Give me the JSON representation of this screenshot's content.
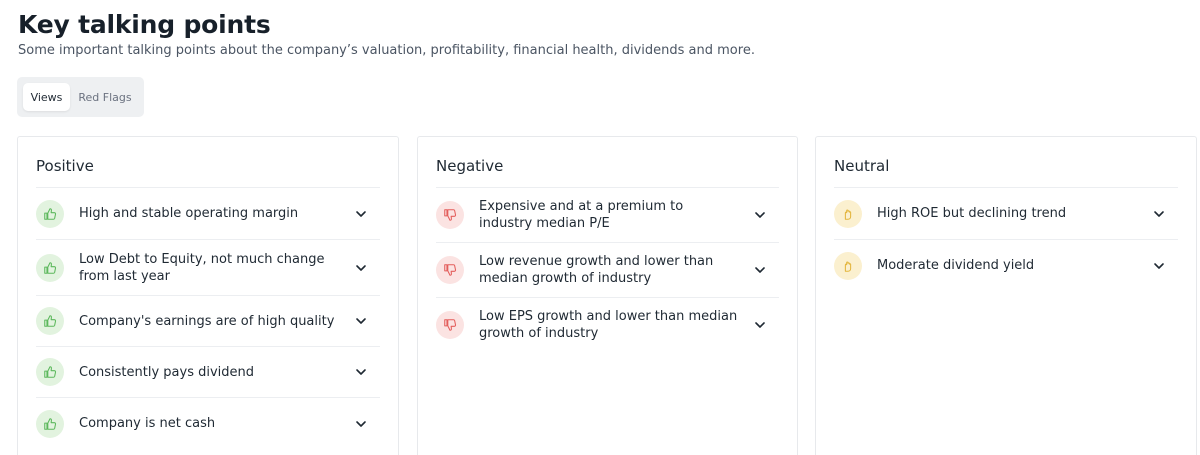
{
  "header": {
    "title": "Key talking points",
    "subtitle": "Some important talking points about the company’s valuation, profitability, financial health, dividends and more."
  },
  "tabs": [
    {
      "label": "Views",
      "active": true
    },
    {
      "label": "Red Flags",
      "active": false
    }
  ],
  "colors": {
    "positive_icon": "#5cb85c",
    "negative_icon": "#e35d5b",
    "neutral_icon": "#e3b53c"
  },
  "columns": {
    "positive": {
      "title": "Positive",
      "items": [
        "High and stable operating margin",
        "Low Debt to Equity, not much change from last year",
        "Company's earnings are of high quality",
        "Consistently pays dividend",
        "Company is net cash"
      ]
    },
    "negative": {
      "title": "Negative",
      "items": [
        "Expensive and at a premium to industry median P/E",
        "Low revenue growth and lower than median growth of industry",
        "Low EPS growth and lower than median growth of industry"
      ]
    },
    "neutral": {
      "title": "Neutral",
      "items": [
        "High ROE but declining trend",
        "Moderate dividend yield"
      ]
    }
  }
}
